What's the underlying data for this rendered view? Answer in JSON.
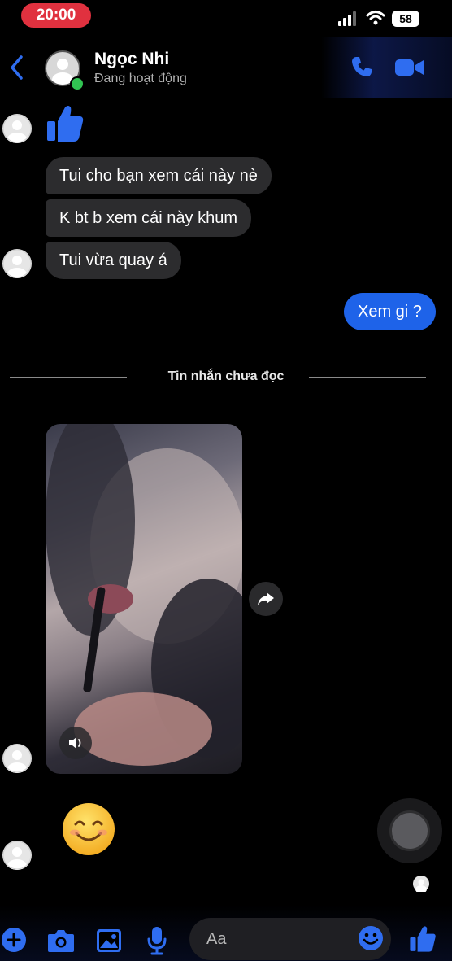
{
  "status_bar": {
    "time": "20:00",
    "battery": "58"
  },
  "header": {
    "contact_name": "Ngọc Nhi",
    "contact_status": "Đang hoạt động"
  },
  "messages": {
    "received": [
      "Tui cho bạn xem cái này nè",
      "K bt b xem cái này khum",
      "Tui vừa quay á"
    ],
    "sent": "Xem gi ?"
  },
  "divider": {
    "label": "Tin nhắn chưa đọc"
  },
  "composer": {
    "placeholder": "Aa"
  },
  "colors": {
    "accent": "#1e63e9",
    "bubble_received": "#2c2c2e",
    "clock_pill": "#e0313f",
    "online": "#31c452"
  },
  "icons": [
    "back-arrow-icon",
    "phone-icon",
    "video-camera-icon",
    "thumbs-up-icon",
    "share-arrow-icon",
    "speaker-icon",
    "smiley-emoji",
    "plus-icon",
    "camera-icon",
    "image-icon",
    "microphone-icon",
    "emoji-icon"
  ]
}
